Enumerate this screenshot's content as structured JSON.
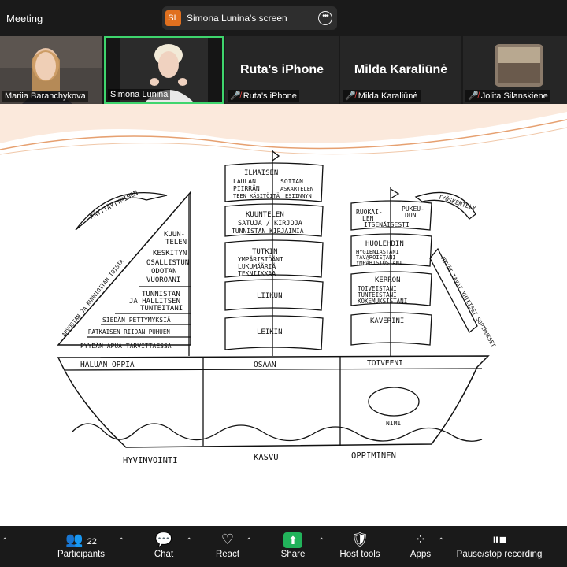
{
  "header": {
    "meeting_title": "Meeting",
    "share_badge": "SL",
    "share_label": "Simona Lunina's screen"
  },
  "participants_strip": [
    {
      "name": "Mariia Baranchykova",
      "has_video": true,
      "muted": false
    },
    {
      "name": "Simona Lunina",
      "has_video": true,
      "muted": false,
      "active": true
    },
    {
      "name": "Ruta's iPhone",
      "display": "Ruta's iPhone",
      "has_video": false,
      "muted": true
    },
    {
      "name": "Milda Karaliūnė",
      "display": "Milda Karaliūnė",
      "has_video": false,
      "muted": true
    },
    {
      "name": "Jolita Silanskiene",
      "has_video": true,
      "muted": true
    }
  ],
  "slide": {
    "left_sail_top_banner": "KÄYTTÄYTYMINEN",
    "left_sail_side_banner": "ARVOSTAN JA KUNNIOITAN TOISIA",
    "left_sail_lines": [
      "KUUN-",
      "TELEN",
      "KESKITYN",
      "OSALLISTUN",
      "ODOTAN",
      "VUOROANI",
      "TUNNISTAN",
      "JA HALLITSEN",
      "TUNTEITANI",
      "SIEDÄN PETTYMYKSIÄ",
      "RATKAISEN RIIDAN PUHUEN",
      "PYYDÄN APUA TARVITTAESSA"
    ],
    "mid_sail_1": {
      "title": "ILMAISEN",
      "items": [
        "LAULAN",
        "SOITAN",
        "PIIRRÄN",
        "ASKARTELEN",
        "TEEN KÄSITÖITÄ",
        "ESIINNYN"
      ]
    },
    "mid_sail_2": [
      "KUUNTELEN",
      "SATUJA / KIRJOJA",
      "TUNNISTAN KIRJAIMIA"
    ],
    "mid_sail_3": {
      "title": "TUTKIN",
      "items": [
        "YMPÄRISTÖÄNI",
        "LUKUMÄÄRIÄ",
        "TEKNIIKKAA"
      ]
    },
    "mid_sail_4": "LIIKUN",
    "mid_sail_5": "LEIKIN",
    "right_flag": "TYÖSKENTELY",
    "right_side_banner": "HYVÄT TAVAT YHTEISET SOPIMUKSET",
    "right_sail_1": [
      "RUOKAI-",
      "PUKEU-",
      "LEN",
      "DUN",
      "ITSENÄISESTI"
    ],
    "right_sail_2": {
      "title": "HUOLEHDIN",
      "items": [
        "HYGIENIASTANI",
        "TAVAROISTANI",
        "YMPÄRISTÖSTÄNI"
      ]
    },
    "right_sail_3": {
      "title": "KERRON",
      "items": [
        "TOIVEISTANI",
        "TUNTEISTANI",
        "KOKEMUKSISTANI"
      ]
    },
    "right_sail_4": "KAVERINI",
    "hull_left": "HALUAN OPPIA",
    "hull_mid": "OSAAN",
    "hull_right": "TOIVEENI",
    "porthole_label": "NIMI",
    "water_left": "HYVINVOINTI",
    "water_mid": "KASVU",
    "water_right": "OPPIMINEN"
  },
  "toolbar": {
    "participants_count": "22",
    "participants": "Participants",
    "chat": "Chat",
    "react": "React",
    "share": "Share",
    "host_tools": "Host tools",
    "apps": "Apps",
    "record": "Pause/stop recording"
  }
}
